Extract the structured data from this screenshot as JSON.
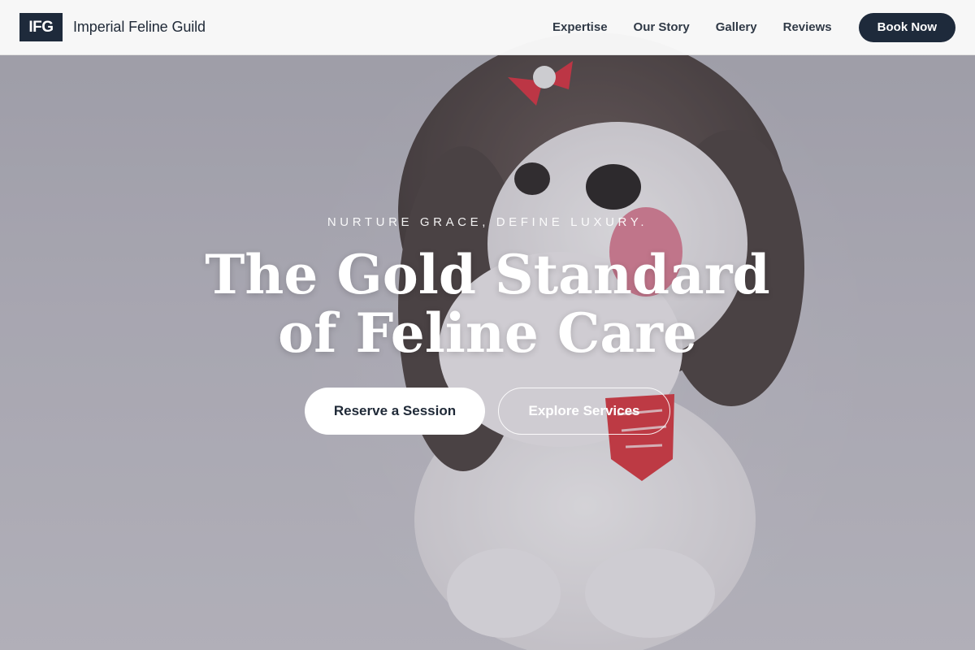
{
  "brand": {
    "logo_text": "IFG",
    "name": "Imperial Feline Guild"
  },
  "nav": {
    "items": [
      {
        "label": "Expertise"
      },
      {
        "label": "Our Story"
      },
      {
        "label": "Gallery"
      },
      {
        "label": "Reviews"
      }
    ],
    "cta_label": "Book Now"
  },
  "hero": {
    "tagline": "NURTURE GRACE, DEFINE LUXURY.",
    "headline_line1": "The Gold Standard",
    "headline_line2": "of Feline Care",
    "primary_cta": "Reserve a Session",
    "secondary_cta": "Explore Services"
  },
  "colors": {
    "brand_navy": "#1e2a3b",
    "header_bg": "#fafafa",
    "hero_text": "#ffffff"
  }
}
